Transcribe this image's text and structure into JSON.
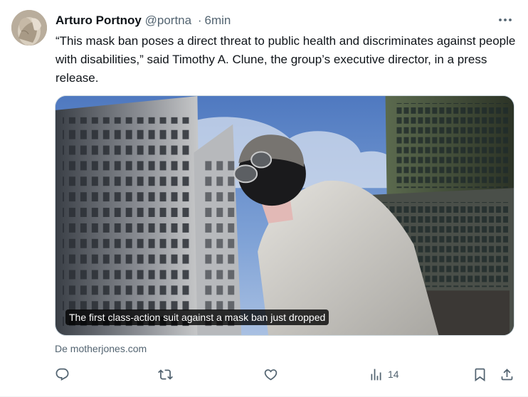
{
  "tweet": {
    "display_name": "Arturo Portnoy",
    "handle": "@portna",
    "separator": "·",
    "time": "6min",
    "text": "“This mask ban poses a direct threat to public health and discriminates against people with disabilities,” said Timothy A. Clune, the group’s executive director, in a press release.",
    "media": {
      "caption": "The first class-action suit against a mask ban just dropped"
    },
    "source": "De motherjones.com",
    "actions": {
      "reply_icon": "reply-icon",
      "retweet_icon": "retweet-icon",
      "like_icon": "heart-icon",
      "views_icon": "views-bar-icon",
      "views_count": "14",
      "bookmark_icon": "bookmark-icon",
      "share_icon": "share-icon"
    }
  },
  "colors": {
    "text_primary": "#0f1419",
    "text_secondary": "#536471",
    "border": "#cfd9de"
  }
}
